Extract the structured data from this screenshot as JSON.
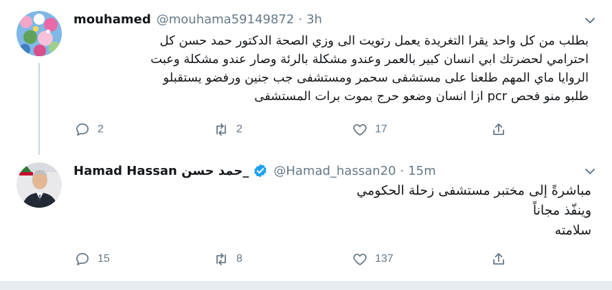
{
  "tweets": [
    {
      "name": "mouhamed",
      "handle": "@mouhama59149872",
      "separator": "·",
      "time": "3h",
      "verified": false,
      "lines": [
        "بطلب من كل واحد يقرا التغريدة يعمل رتويت الى وزي الصحة الدكتور حمد حسن  كل",
        "احترامي لحضرتك ابي انسان كبير بالعمر وعندو مشكلة بالرئة وصار عندو مشكلة وعبت",
        "الروايا ماي المهم طلعنا على مستشفى سحمر ومستشفى جب جنين ورفضو يستقبلو",
        "طلبو منو فحص pcr  ازا انسان وضعو حرج بموت برات المستشفى"
      ],
      "actions": {
        "reply": "2",
        "retweet": "2",
        "like": "17"
      }
    },
    {
      "name": "Hamad Hassan حمد حسن_",
      "handle": "@Hamad_hassan20",
      "separator": "·",
      "time": "15m",
      "verified": true,
      "lines": [
        "مباشرةً إلى مختبر مستشفى زحلة الحكومي",
        "وينفّذ مجاناً",
        "سلامته"
      ],
      "actions": {
        "reply": "15",
        "retweet": "8",
        "like": "137"
      }
    }
  ],
  "colors": {
    "verified": "#1da1f2",
    "muted": "#657786",
    "border": "#e6ecf0"
  }
}
